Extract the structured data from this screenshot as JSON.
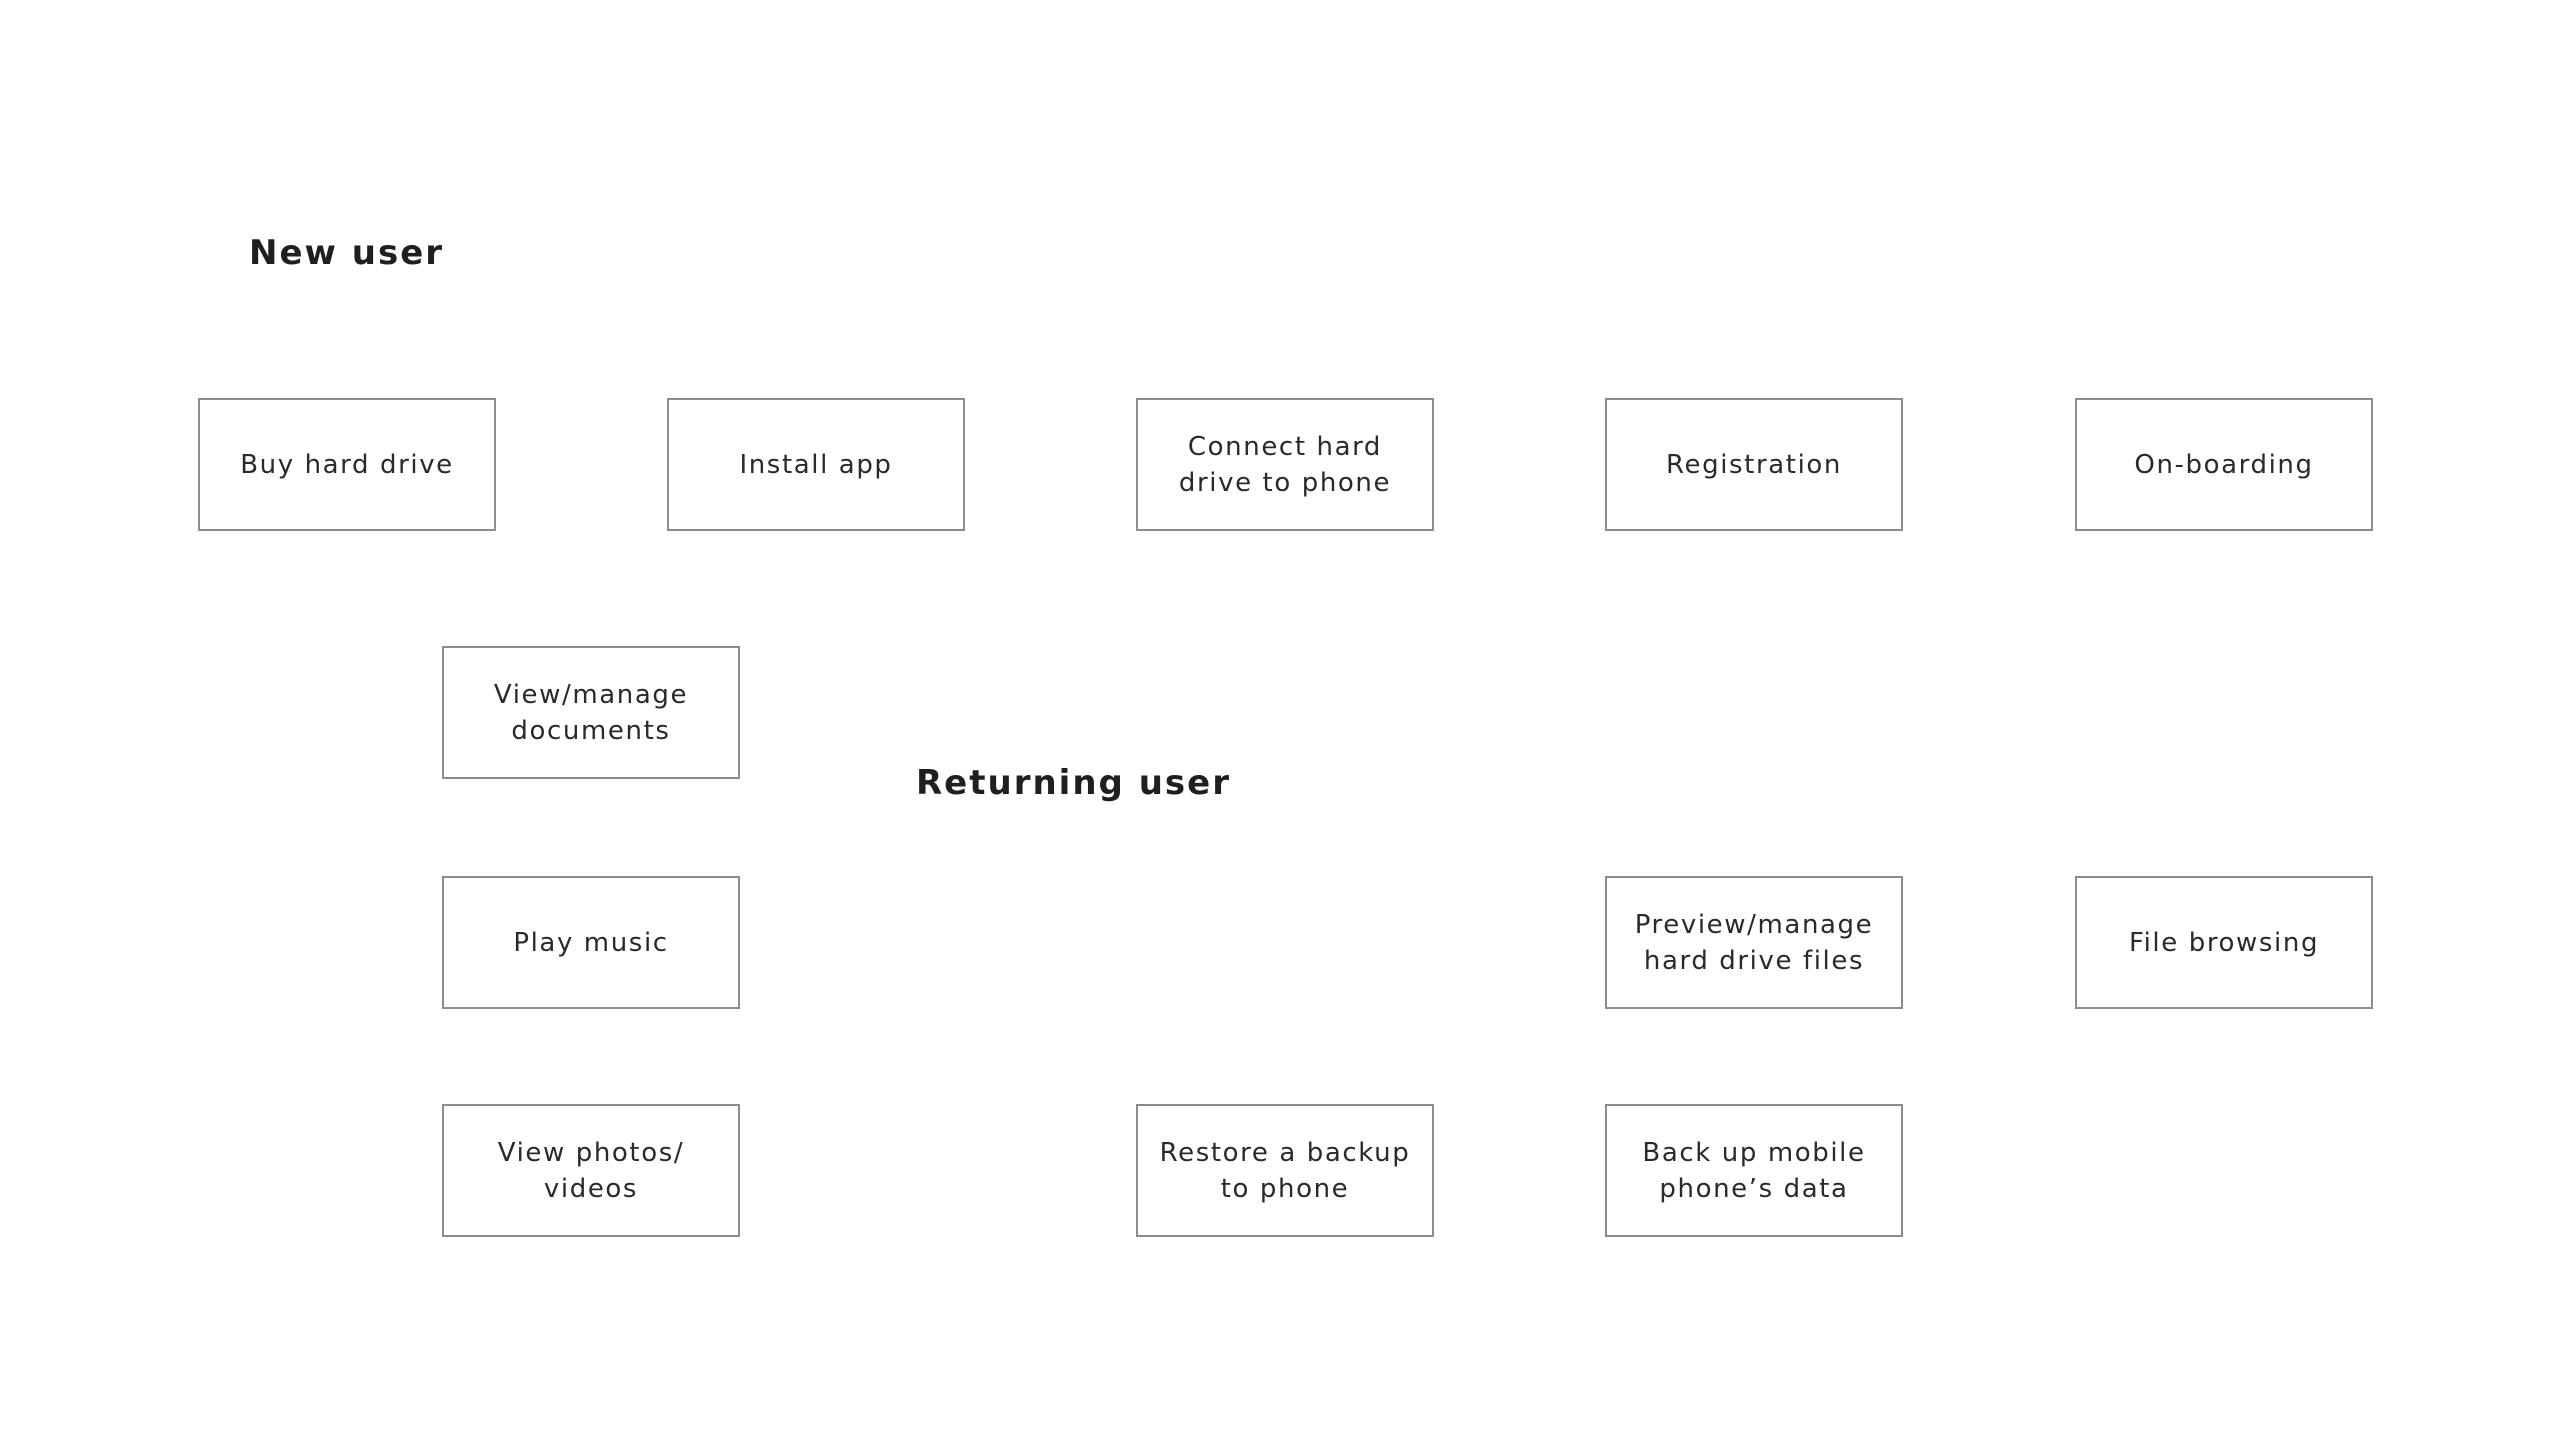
{
  "sections": {
    "new_user": {
      "title": "New user",
      "steps": [
        "Buy hard drive",
        "Install app",
        "Connect hard\ndrive to phone",
        "Registration",
        "On-boarding"
      ]
    },
    "returning_user": {
      "title": "Returning user",
      "features": {
        "view_documents": "View/manage\ndocuments",
        "play_music": "Play music",
        "view_photos": "View photos/\nvideos",
        "restore_backup": "Restore a backup\nto phone",
        "preview_files": "Preview/manage\nhard drive files",
        "backup_data": "Back up mobile\nphone’s data",
        "file_browsing": "File browsing"
      }
    }
  },
  "colors": {
    "box_border": "#8c8c8c",
    "text": "#2a2a2a",
    "heading": "#1f1f1f",
    "background": "#ffffff"
  }
}
